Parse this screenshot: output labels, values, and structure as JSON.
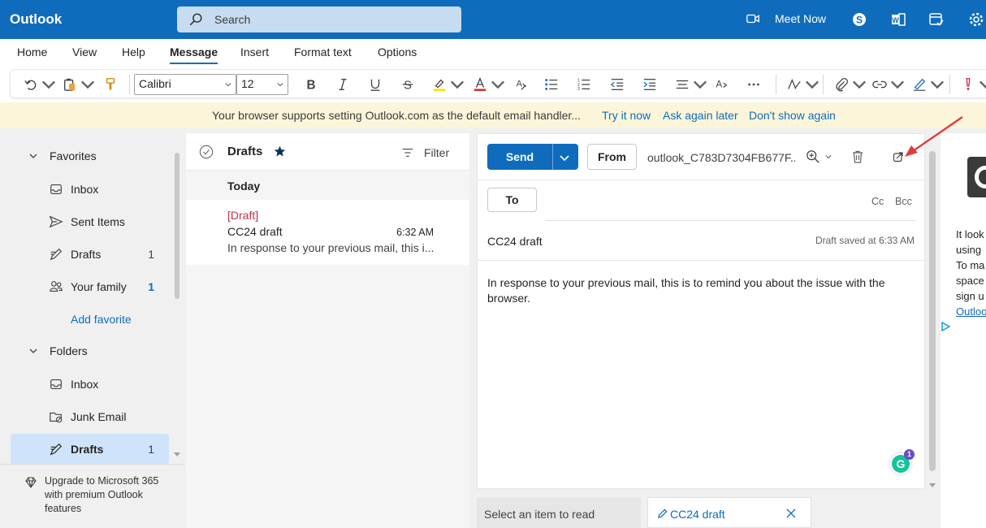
{
  "app": {
    "title": "Outlook"
  },
  "search": {
    "placeholder": "Search"
  },
  "topbar": {
    "meet_now": "Meet Now"
  },
  "ribbon": {
    "tabs": [
      "Home",
      "View",
      "Help",
      "Message",
      "Insert",
      "Format text",
      "Options"
    ],
    "active_tab": "Message"
  },
  "toolbar": {
    "font_name": "Calibri",
    "font_size": "12"
  },
  "infobar": {
    "message": "Your browser supports setting Outlook.com as the default email handler...",
    "try_now": "Try it now",
    "ask_later": "Ask again later",
    "dont_show": "Don't show again"
  },
  "folders": {
    "favorites_label": "Favorites",
    "favorites": [
      {
        "label": "Inbox",
        "count": ""
      },
      {
        "label": "Sent Items",
        "count": ""
      },
      {
        "label": "Drafts",
        "count": "1"
      },
      {
        "label": "Your family",
        "count": "1"
      }
    ],
    "add_favorite": "Add favorite",
    "folders_label": "Folders",
    "folders": [
      {
        "label": "Inbox",
        "count": ""
      },
      {
        "label": "Junk Email",
        "count": ""
      },
      {
        "label": "Drafts",
        "count": "1"
      }
    ],
    "upgrade": "Upgrade to Microsoft 365 with premium Outlook features"
  },
  "list": {
    "title": "Drafts",
    "filter": "Filter",
    "group": "Today",
    "messages": [
      {
        "tag": "[Draft]",
        "subject": "CC24 draft",
        "time": "6:32 AM",
        "preview": "In response to your previous mail, this i..."
      }
    ]
  },
  "compose": {
    "send": "Send",
    "from": "From",
    "from_address": "outlook_C783D7304FB677F...",
    "to": "To",
    "cc": "Cc",
    "bcc": "Bcc",
    "subject": "CC24 draft",
    "saved_status": "Draft saved at 6:33 AM",
    "body": "In response to your previous mail, this is to remind you about the issue with the browser.",
    "grammarly_count": "1"
  },
  "bottom_tabs": {
    "read": "Select an item to read",
    "draft": "CC24 draft"
  },
  "ad": {
    "lines": [
      "It look",
      "using",
      "To ma",
      "space",
      "sign u"
    ],
    "link": "Outloo"
  },
  "colors": {
    "brand": "#0f6cbd",
    "infobar": "#fbf6d9",
    "selected": "#cfe4fa",
    "draft_tag": "#c4314b",
    "annotation": "#e03c3c"
  }
}
